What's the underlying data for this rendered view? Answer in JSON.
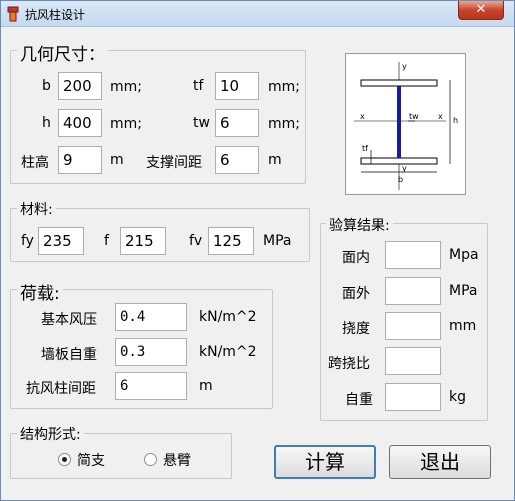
{
  "window": {
    "title": "抗风柱设计",
    "close_glyph": "✕"
  },
  "geometry": {
    "label": "几何尺寸：",
    "b": {
      "label": "b",
      "value": "200",
      "unit": "mm;"
    },
    "tf": {
      "label": "tf",
      "value": "10",
      "unit": "mm;"
    },
    "h": {
      "label": "h",
      "value": "400",
      "unit": "mm;"
    },
    "tw": {
      "label": "tw",
      "value": "6",
      "unit": "mm;"
    },
    "height": {
      "label": "柱高",
      "value": "9",
      "unit": "m"
    },
    "brace": {
      "label": "支撑间距",
      "value": "6",
      "unit": "m"
    }
  },
  "section_diagram": {
    "y_top": "y",
    "y_bottom": "y",
    "x_left": "x",
    "x_right": "x",
    "tw": "tw",
    "tf": "tf",
    "b": "b",
    "h": "h"
  },
  "material": {
    "label": "材料:",
    "fy": {
      "label": "fy",
      "value": "235"
    },
    "f": {
      "label": "f",
      "value": "215"
    },
    "fv": {
      "label": "fv",
      "value": "125",
      "unit": "MPa"
    }
  },
  "load": {
    "label": "荷载:",
    "wind": {
      "label": "基本风压",
      "value": "0.4",
      "unit": "kN/m^2"
    },
    "wall": {
      "label": "墙板自重",
      "value": "0.3",
      "unit": "kN/m^2"
    },
    "spacing": {
      "label": "抗风柱间距",
      "value": "6",
      "unit": "m"
    }
  },
  "structure": {
    "label": "结构形式:",
    "options": [
      {
        "label": "简支",
        "selected": true
      },
      {
        "label": "悬臂",
        "selected": false
      }
    ]
  },
  "results": {
    "label": "验算结果:",
    "in_plane": {
      "label": "面内",
      "value": "",
      "unit": "Mpa"
    },
    "out_plane": {
      "label": "面外",
      "value": "",
      "unit": "MPa"
    },
    "deflection": {
      "label": "挠度",
      "value": "",
      "unit": "mm"
    },
    "span_ratio": {
      "label": "跨挠比",
      "value": ""
    },
    "self_weight": {
      "label": "自重",
      "value": "",
      "unit": "kg"
    }
  },
  "buttons": {
    "calculate": "计算",
    "exit": "退出"
  }
}
